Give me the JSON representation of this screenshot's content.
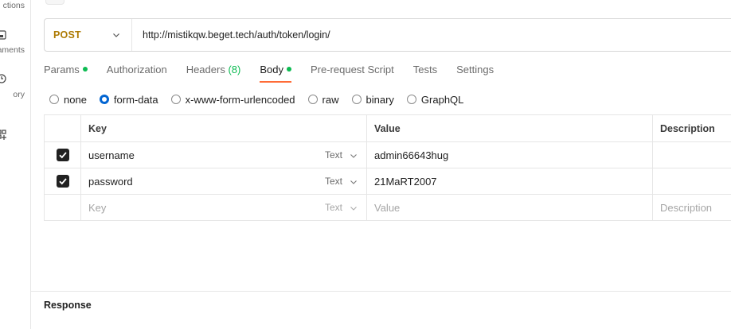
{
  "sidebar": {
    "items": [
      {
        "label": "ctions",
        "icon": "collections-icon"
      },
      {
        "label": "aments",
        "icon": "environments-icon"
      },
      {
        "label": "ory",
        "icon": "history-icon"
      },
      {
        "label": "",
        "icon": "add-workspace-icon"
      }
    ]
  },
  "request": {
    "method": "POST",
    "url": "http://mistikqw.beget.tech/auth/token/login/"
  },
  "tabs": [
    {
      "label": "Params",
      "dot": true,
      "count": ""
    },
    {
      "label": "Authorization",
      "dot": false,
      "count": ""
    },
    {
      "label": "Headers",
      "dot": false,
      "count": "(8)"
    },
    {
      "label": "Body",
      "dot": true,
      "count": "",
      "active": true
    },
    {
      "label": "Pre-request Script",
      "dot": false,
      "count": ""
    },
    {
      "label": "Tests",
      "dot": false,
      "count": ""
    },
    {
      "label": "Settings",
      "dot": false,
      "count": ""
    }
  ],
  "body_types": [
    {
      "label": "none",
      "checked": false
    },
    {
      "label": "form-data",
      "checked": true
    },
    {
      "label": "x-www-form-urlencoded",
      "checked": false
    },
    {
      "label": "raw",
      "checked": false
    },
    {
      "label": "binary",
      "checked": false
    },
    {
      "label": "GraphQL",
      "checked": false
    }
  ],
  "table": {
    "headers": {
      "key": "Key",
      "value": "Value",
      "description": "Description"
    },
    "rows": [
      {
        "key": "username",
        "type": "Text",
        "value": "admin66643hug",
        "checked": true
      },
      {
        "key": "password",
        "type": "Text",
        "value": "21MaRT2007",
        "checked": true
      }
    ],
    "placeholder": {
      "key": "Key",
      "type": "Text",
      "value": "Value",
      "description": "Description"
    }
  },
  "colors": {
    "method_post": "#ad7a03",
    "active_tab_underline": "#ff6c37",
    "indicator_dot": "#0cbb52",
    "radio_checked": "#0265d2"
  },
  "response": {
    "label": "Response"
  }
}
